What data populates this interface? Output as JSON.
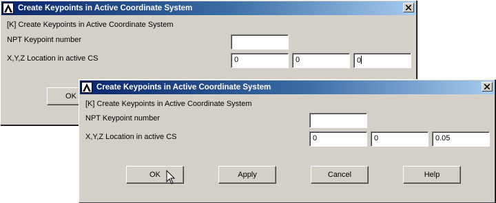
{
  "back_dialog": {
    "title": "Create Keypoints in Active Coordinate System",
    "header": "[K]  Create Keypoints in Active Coordinate System",
    "npt_label": "NPT    Keypoint number",
    "npt_value": "",
    "xyz_label": "X,Y,Z  Location in active CS",
    "x_value": "0",
    "y_value": "0",
    "z_value": "0",
    "ok_label": "OK",
    "icons": {
      "app": "ansys-logo-icon",
      "close": "close-icon"
    }
  },
  "front_dialog": {
    "title": "Create Keypoints in Active Coordinate System",
    "header": "[K]  Create Keypoints in Active Coordinate System",
    "npt_label": "NPT    Keypoint number",
    "npt_value": "",
    "xyz_label": "X,Y,Z  Location in active CS",
    "x_value": "0",
    "y_value": "0",
    "z_value": "0.05",
    "buttons": {
      "ok": "OK",
      "apply": "Apply",
      "cancel": "Cancel",
      "help": "Help"
    },
    "icons": {
      "app": "ansys-logo-icon",
      "close": "close-icon",
      "cursor": "mouse-pointer-icon"
    }
  },
  "colors": {
    "dialog_face": "#d4d0c8",
    "titlebar_start": "#0a246a",
    "titlebar_end": "#a6caf0"
  }
}
